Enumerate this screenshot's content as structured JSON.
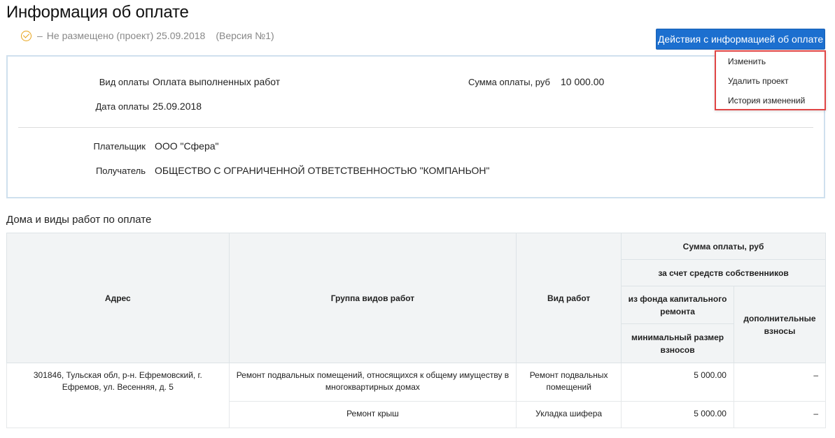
{
  "page": {
    "title": "Информация об оплате",
    "status_dash": "–",
    "status_text": "Не размещено (проект) 25.09.2018",
    "version": "(Версия №1)",
    "actions_button": "Действия с информацией об оплате",
    "dropdown": {
      "items": [
        "Изменить",
        "Удалить проект",
        "История изменений"
      ]
    }
  },
  "payment": {
    "type_label": "Вид оплаты",
    "type_value": "Оплата выполненных работ",
    "amount_label": "Сумма оплаты, руб",
    "amount_value": "10 000.00",
    "date_label": "Дата оплаты",
    "date_value": "25.09.2018",
    "payer_label": "Плательщик",
    "payer_value": "ООО \"Сфера\"",
    "recipient_label": "Получатель",
    "recipient_value": "ОБЩЕСТВО С ОГРАНИЧЕННОЙ ОТВЕТСТВЕННОСТЬЮ \"КОМПАНЬОН\""
  },
  "works_section": {
    "title": "Дома и виды работ по оплате",
    "headers": {
      "address": "Адрес",
      "work_group": "Группа видов работ",
      "work_type": "Вид работ",
      "payment_sum": "Сумма оплаты, руб",
      "owners_funds": "за счет средств собственников",
      "capital_fund": "из фонда капитального ремонта",
      "min_contribution": "минимальный размер взносов",
      "additional": "дополнительные взносы"
    },
    "address": "301846, Тульская обл, р-н. Ефремовский, г. Ефремов, ул. Весенняя, д. 5",
    "rows": [
      {
        "work_group": "Ремонт подвальных помещений, относящихся к общему имуществу в многоквартирных домах",
        "work_type": "Ремонт подвальных помещений",
        "min_amount": "5 000.00",
        "additional": "–"
      },
      {
        "work_group": "Ремонт крыш",
        "work_type": "Укладка шифера",
        "min_amount": "5 000.00",
        "additional": "–"
      }
    ]
  }
}
